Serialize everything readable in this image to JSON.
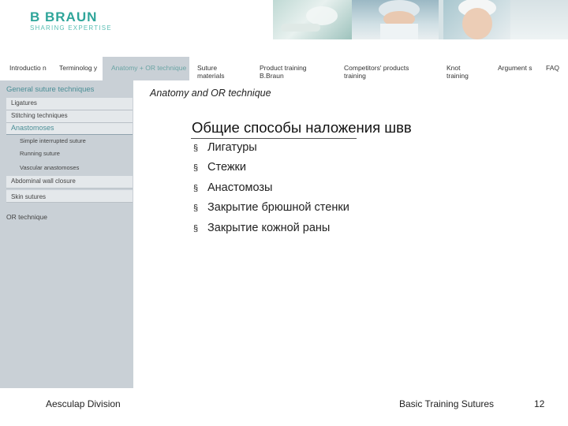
{
  "header": {
    "brand": "B BRAUN",
    "tagline": "SHARING EXPERTISE"
  },
  "top_nav": [
    "Introductio n",
    "Terminolog y",
    "Anatomy + OR technique",
    "Suture materials",
    "Product training B.Braun",
    "Competitors' products training",
    "Knot training",
    "Argument s",
    "FAQ"
  ],
  "sidebar": {
    "title": "General suture techniques",
    "items": [
      "Ligatures",
      "Stitching techniques",
      "Anastomoses",
      "Simple interrupted suture",
      "Running suture",
      "Vascular anastomoses",
      "Abdominal wall closure",
      "Skin sutures",
      "OR technique"
    ]
  },
  "content": {
    "section_title": "Anatomy and OR technique",
    "heading": "Общие способы наложения швв",
    "bullet_mark": "§",
    "bullets": [
      "Лигатуры",
      "Стежки",
      "Анастомозы",
      "Закрытие брюшной стенки",
      "Закрытие кожной раны"
    ]
  },
  "footer": {
    "left": "Aesculap Division",
    "right": "Basic Training Sutures",
    "page": "12"
  },
  "colors": {
    "brand": "#2fa59a",
    "sidebar_bg": "#c9d0d6",
    "accent_text": "#4a8e96"
  }
}
